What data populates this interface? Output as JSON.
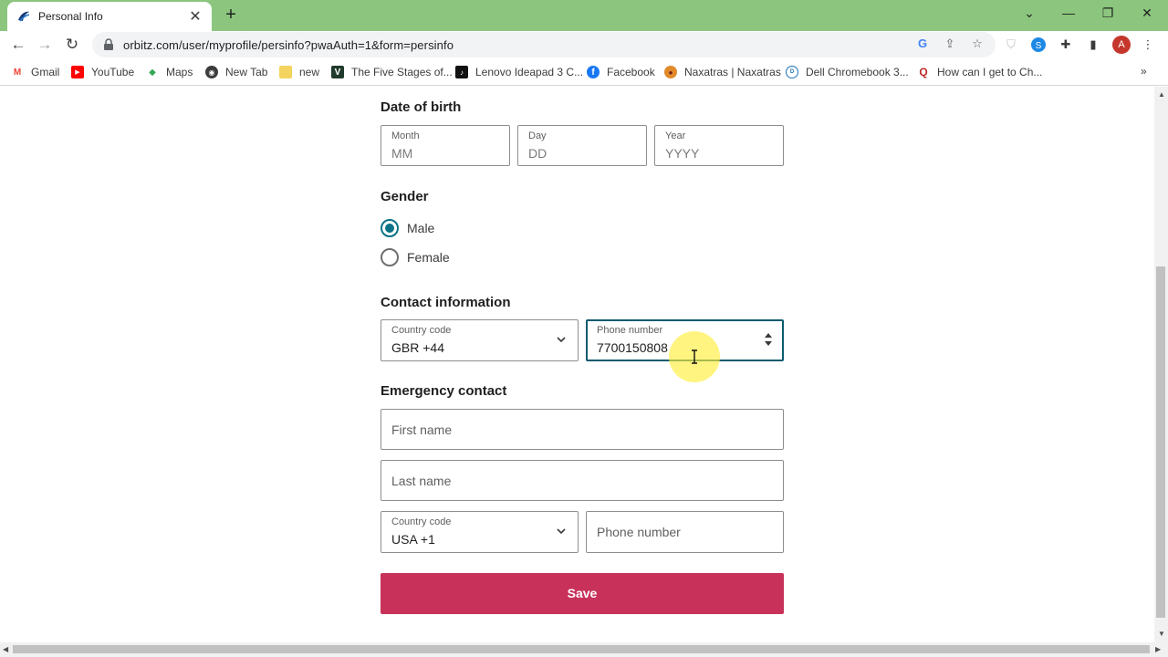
{
  "browser": {
    "tab_title": "Personal Info",
    "url": "orbitz.com/user/myprofile/persinfo?pwaAuth=1&form=persinfo",
    "profile_initial": "A",
    "bookmarks": [
      {
        "label": "Gmail"
      },
      {
        "label": "YouTube"
      },
      {
        "label": "Maps"
      },
      {
        "label": "New Tab"
      },
      {
        "label": "new"
      },
      {
        "label": "The Five Stages of..."
      },
      {
        "label": "Lenovo Ideapad 3 C..."
      },
      {
        "label": "Facebook"
      },
      {
        "label": "Naxatras | Naxatras"
      },
      {
        "label": "Dell Chromebook 3..."
      },
      {
        "label": "How can I get to Ch..."
      }
    ]
  },
  "form": {
    "dob": {
      "title": "Date of birth",
      "month": {
        "label": "Month",
        "placeholder": "MM"
      },
      "day": {
        "label": "Day",
        "placeholder": "DD"
      },
      "year": {
        "label": "Year",
        "placeholder": "YYYY"
      }
    },
    "gender": {
      "title": "Gender",
      "options": [
        {
          "label": "Male",
          "checked": true
        },
        {
          "label": "Female",
          "checked": false
        }
      ]
    },
    "contact": {
      "title": "Contact information",
      "country_code": {
        "label": "Country code",
        "value": "GBR +44"
      },
      "phone": {
        "label": "Phone number",
        "value": "7700150808"
      }
    },
    "emergency": {
      "title": "Emergency contact",
      "first_name": {
        "placeholder": "First name"
      },
      "last_name": {
        "placeholder": "Last name"
      },
      "country_code": {
        "label": "Country code",
        "value": "USA +1"
      },
      "phone": {
        "placeholder": "Phone number"
      }
    },
    "save_label": "Save"
  },
  "colors": {
    "chrome_frame": "#8cc67e",
    "save_button": "#c8325a",
    "radio_accent": "#0b7285",
    "focus_border": "#0b5b6e"
  }
}
